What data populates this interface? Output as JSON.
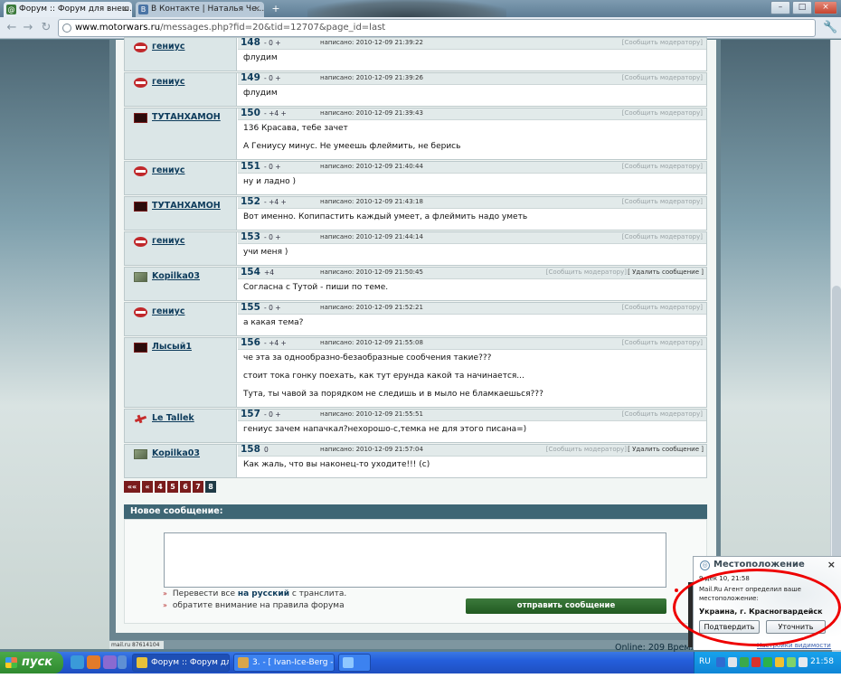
{
  "browser": {
    "tabs": [
      {
        "title": "Форум :: Форум для внеш...",
        "favicon_color": "#3b7a3b"
      },
      {
        "title": "В Контакте | Наталья Че...",
        "favicon_color": "#4a74a5"
      }
    ],
    "url_host": "www.motorwars.ru",
    "url_path": "/messages.php?fid=20&tid=12707&page_id=last"
  },
  "posts": [
    {
      "num": "148",
      "author": "гениус",
      "avatar": "stop",
      "rating": "- 0 +",
      "written": "написано: 2010-12-09 21:39:22",
      "report": "[Сообщить модератору]",
      "delete": "",
      "lines": [
        "флудим"
      ]
    },
    {
      "num": "149",
      "author": "гениус",
      "avatar": "stop",
      "rating": "- 0 +",
      "written": "написано: 2010-12-09 21:39:26",
      "report": "[Сообщить модератору]",
      "delete": "",
      "lines": [
        "флудим"
      ]
    },
    {
      "num": "150",
      "author": "ТУТАНХАМОН",
      "avatar": "dark",
      "rating": "- +4 +",
      "written": "написано: 2010-12-09 21:39:43",
      "report": "[Сообщить модератору]",
      "delete": "",
      "lines": [
        "136 Красава, тебе зачет",
        "А Гениусу минус. Не умеешь флеймить, не берись"
      ]
    },
    {
      "num": "151",
      "author": "гениус",
      "avatar": "stop",
      "rating": "- 0 +",
      "written": "написано: 2010-12-09 21:40:44",
      "report": "[Сообщить модератору]",
      "delete": "",
      "lines": [
        "ну и ладно )"
      ]
    },
    {
      "num": "152",
      "author": "ТУТАНХАМОН",
      "avatar": "dark",
      "rating": "- +4 +",
      "written": "написано: 2010-12-09 21:43:18",
      "report": "[Сообщить модератору]",
      "delete": "",
      "lines": [
        "Вот именно. Копипастить каждый умеет, а флеймить надо уметь"
      ]
    },
    {
      "num": "153",
      "author": "гениус",
      "avatar": "stop",
      "rating": "- 0 +",
      "written": "написано: 2010-12-09 21:44:14",
      "report": "[Сообщить модератору]",
      "delete": "",
      "lines": [
        "учи меня )"
      ]
    },
    {
      "num": "154",
      "author": "Kopilka03",
      "avatar": "pic",
      "rating": "+4",
      "written": "написано: 2010-12-09 21:50:45",
      "report": "[Сообщить модератору]",
      "delete": "[ Удалить сообщение ]",
      "lines": [
        "Согласна с Тутой - пиши по теме."
      ]
    },
    {
      "num": "155",
      "author": "гениус",
      "avatar": "stop",
      "rating": "- 0 +",
      "written": "написано: 2010-12-09 21:52:21",
      "report": "[Сообщить модератору]",
      "delete": "",
      "lines": [
        "а какая тема?"
      ]
    },
    {
      "num": "156",
      "author": "Лысый1",
      "avatar": "dark",
      "rating": "- +4 +",
      "written": "написано: 2010-12-09 21:55:08",
      "report": "[Сообщить модератору]",
      "delete": "",
      "lines": [
        "че эта за однообразно-безаобразные сообчения такие???",
        "стоит тока гонку поехать, как тут ерунда какой та начинается...",
        "Тута, ты чавой за порядком не следишь и в мыло не бламкаешься???"
      ]
    },
    {
      "num": "157",
      "author": "Le Tallek",
      "avatar": "plane",
      "rating": "- 0 +",
      "written": "написано: 2010-12-09 21:55:51",
      "report": "[Сообщить модератору]",
      "delete": "",
      "lines": [
        "гениус зачем напачкал?нехорошо-с,темка не для этого писана=)"
      ]
    },
    {
      "num": "158",
      "author": "Kopilka03",
      "avatar": "pic",
      "rating": "0",
      "written": "написано: 2010-12-09 21:57:04",
      "report": "[Сообщить модератору]",
      "delete": "[ Удалить сообщение ]",
      "lines": [
        "Как жаль, что вы наконец-то уходите!!! (с)"
      ]
    }
  ],
  "pagination": [
    "««",
    "«",
    "4",
    "5",
    "6",
    "7",
    "8"
  ],
  "new_message": {
    "title": "Новое сообщение:",
    "opt1_pre": "Перевести все",
    "opt1_bold": "на русский",
    "opt1_post": "с транслита.",
    "opt2": "обратите внимание на правила форума",
    "send": "отправить сообщение"
  },
  "footer": {
    "counter": "mail.ru 87614104",
    "online": "Online: 209  Время"
  },
  "location_popup": {
    "title": "Местоположение",
    "date": "9 дек 10, 21:58",
    "desc1": "Mail.Ru Агент определил ваше",
    "desc2": "местоположение:",
    "place": "Украина, г. Красногвардейск",
    "confirm": "Подтвердить",
    "refine": "Уточнить",
    "privacy": "Настройки видимости"
  },
  "taskbar": {
    "start": "пуск",
    "tasks": [
      "Форум :: Форум для ...",
      "3. - [ Ivan-Ice-Berg - ..."
    ],
    "lang": "RU",
    "clock": "21:58"
  }
}
